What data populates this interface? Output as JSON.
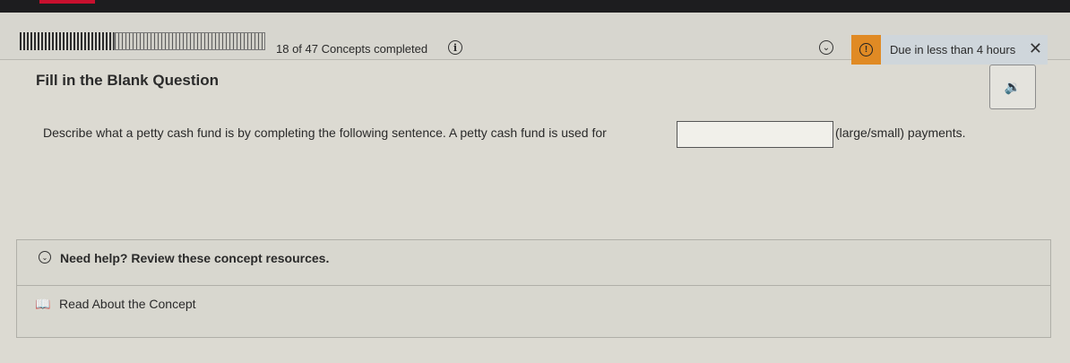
{
  "header": {
    "progress_fraction": 0.383,
    "progress_text": "18 of 47 Concepts completed",
    "info_icon": "info-icon",
    "check_icon": "chevron-down-circle-icon",
    "alert_icon": "alert-icon",
    "due_text": "Due in less than 4 hours",
    "close_icon": "close-icon",
    "colors": {
      "alert": "#e08a24",
      "due_bg": "#cfd6db"
    }
  },
  "question": {
    "type_title": "Fill in the Blank Question",
    "speaker_icon": "speaker-icon",
    "text_before": "Describe what a petty cash fund is by completing the following sentence. A petty cash fund is used for",
    "blank_value": "",
    "text_after": "(large/small) payments."
  },
  "help": {
    "toggle_icon": "chevron-down-circle-icon",
    "title": "Need help? Review these concept resources.",
    "resource_icon": "book-icon",
    "resource_label": "Read About the Concept"
  }
}
